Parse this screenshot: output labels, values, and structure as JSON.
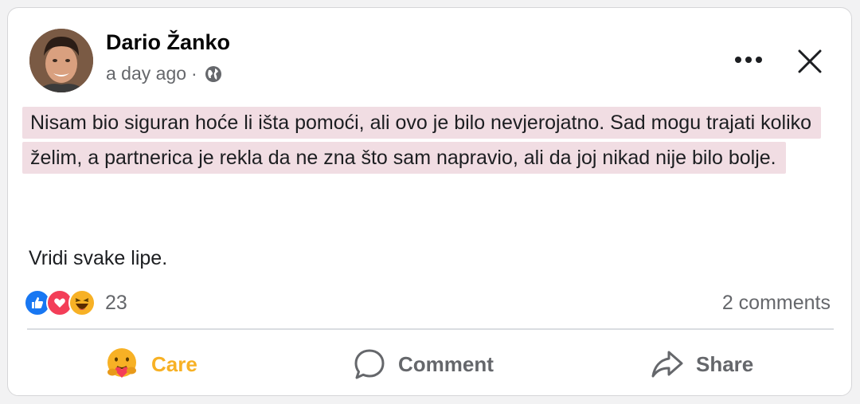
{
  "post": {
    "author_name": "Dario Žanko",
    "timestamp": "a day ago",
    "separator": "·",
    "audience_icon": "globe-icon",
    "body_highlighted": "Nisam bio siguran hoće li išta pomoći, ali ovo je bilo nevjerojatno. Sad mogu trajati koliko želim, a partnerica je rekla da ne zna što sam napravio, ali da joj nikad nije bilo bolje.",
    "body_second": "Vridi svake lipe.",
    "highlight_color": "#f1dde3"
  },
  "header_actions": {
    "more_icon": "more-horizontal-icon",
    "close_icon": "close-icon"
  },
  "stats": {
    "reaction_icons": [
      "like-icon",
      "love-icon",
      "haha-icon"
    ],
    "reaction_count": "23",
    "comments_label": "2 comments"
  },
  "actions": {
    "care_label": "Care",
    "comment_label": "Comment",
    "share_label": "Share",
    "care_color": "#f7b125"
  }
}
